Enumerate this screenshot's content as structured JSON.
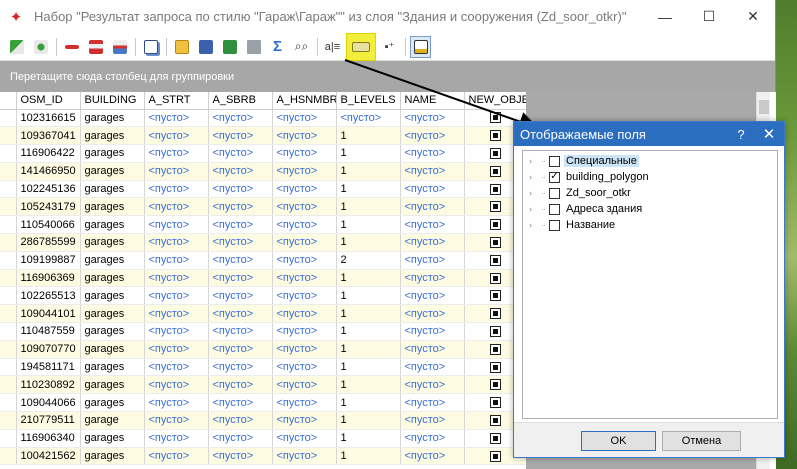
{
  "window": {
    "title": "Набор \"Результат запроса по стилю \"Гараж\\Гараж\"\" из слоя \"Здания и сооружения (Zd_soor_otkr)\"",
    "minimize": "—",
    "maximize": "☐",
    "close": "✕"
  },
  "toolbar": {
    "icons": [
      "add-record-icon",
      "add-record-plus-icon",
      "delete-icon",
      "delete-selected-icon",
      "delete-all-icon",
      "copy-icon",
      "open-folder-icon",
      "save-icon",
      "excel-export-icon",
      "print-icon",
      "sum-icon",
      "find-icon",
      "text-columns-icon",
      "fields-icon",
      "grid-settings-icon",
      "field-chooser-icon"
    ],
    "highlight_color": "#f2ee3c"
  },
  "group_panel": {
    "text": "Перетащите сюда столбец для группировки"
  },
  "grid": {
    "columns": [
      "OSM_ID",
      "BUILDING",
      "A_STRT",
      "A_SBRB",
      "A_HSNMBR",
      "B_LEVELS",
      "NAME",
      "NEW_OBJEC"
    ],
    "rows": [
      [
        "102316615",
        "garages",
        "<пусто>",
        "<пусто>",
        "<пусто>",
        "<пусто>",
        "<пусто>"
      ],
      [
        "109367041",
        "garages",
        "<пусто>",
        "<пусто>",
        "<пусто>",
        "1",
        "<пусто>"
      ],
      [
        "116906422",
        "garages",
        "<пусто>",
        "<пусто>",
        "<пусто>",
        "1",
        "<пусто>"
      ],
      [
        "141466950",
        "garages",
        "<пусто>",
        "<пусто>",
        "<пусто>",
        "1",
        "<пусто>"
      ],
      [
        "102245136",
        "garages",
        "<пусто>",
        "<пусто>",
        "<пусто>",
        "1",
        "<пусто>"
      ],
      [
        "105243179",
        "garages",
        "<пусто>",
        "<пусто>",
        "<пусто>",
        "1",
        "<пусто>"
      ],
      [
        "110540066",
        "garages",
        "<пусто>",
        "<пусто>",
        "<пусто>",
        "1",
        "<пусто>"
      ],
      [
        "286785599",
        "garages",
        "<пусто>",
        "<пусто>",
        "<пусто>",
        "1",
        "<пусто>"
      ],
      [
        "109199887",
        "garages",
        "<пусто>",
        "<пусто>",
        "<пусто>",
        "2",
        "<пусто>"
      ],
      [
        "116906369",
        "garages",
        "<пусто>",
        "<пусто>",
        "<пусто>",
        "1",
        "<пусто>"
      ],
      [
        "102265513",
        "garages",
        "<пусто>",
        "<пусто>",
        "<пусто>",
        "1",
        "<пусто>"
      ],
      [
        "109044101",
        "garages",
        "<пусто>",
        "<пусто>",
        "<пусто>",
        "1",
        "<пусто>"
      ],
      [
        "110487559",
        "garages",
        "<пусто>",
        "<пусто>",
        "<пусто>",
        "1",
        "<пусто>"
      ],
      [
        "109070770",
        "garages",
        "<пусто>",
        "<пусто>",
        "<пусто>",
        "1",
        "<пусто>"
      ],
      [
        "194581171",
        "garages",
        "<пусто>",
        "<пусто>",
        "<пусто>",
        "1",
        "<пусто>"
      ],
      [
        "110230892",
        "garages",
        "<пусто>",
        "<пусто>",
        "<пусто>",
        "1",
        "<пусто>"
      ],
      [
        "109044066",
        "garages",
        "<пусто>",
        "<пусто>",
        "<пусто>",
        "1",
        "<пусто>"
      ],
      [
        "210779511",
        "garage",
        "<пусто>",
        "<пусто>",
        "<пусто>",
        "1",
        "<пусто>"
      ],
      [
        "116906340",
        "garages",
        "<пусто>",
        "<пусто>",
        "<пусто>",
        "1",
        "<пусто>"
      ],
      [
        "100421562",
        "garages",
        "<пусто>",
        "<пусто>",
        "<пусто>",
        "1",
        "<пусто>"
      ]
    ]
  },
  "dialog": {
    "title": "Отображаемые поля",
    "help": "?",
    "close": "✕",
    "items": [
      {
        "label": "Специальные",
        "checked": false,
        "selected": true
      },
      {
        "label": "building_polygon",
        "checked": true,
        "selected": false
      },
      {
        "label": "Zd_soor_otkr",
        "checked": false,
        "selected": false
      },
      {
        "label": "Адреса здания",
        "checked": false,
        "selected": false
      },
      {
        "label": "Название",
        "checked": false,
        "selected": false
      }
    ],
    "ok_label": "OK",
    "cancel_label": "Отмена"
  },
  "colors": {
    "empty_text": "#3a6ed8",
    "alt_row": "#fdfbe2",
    "dialog_title": "#2b6ec0"
  }
}
